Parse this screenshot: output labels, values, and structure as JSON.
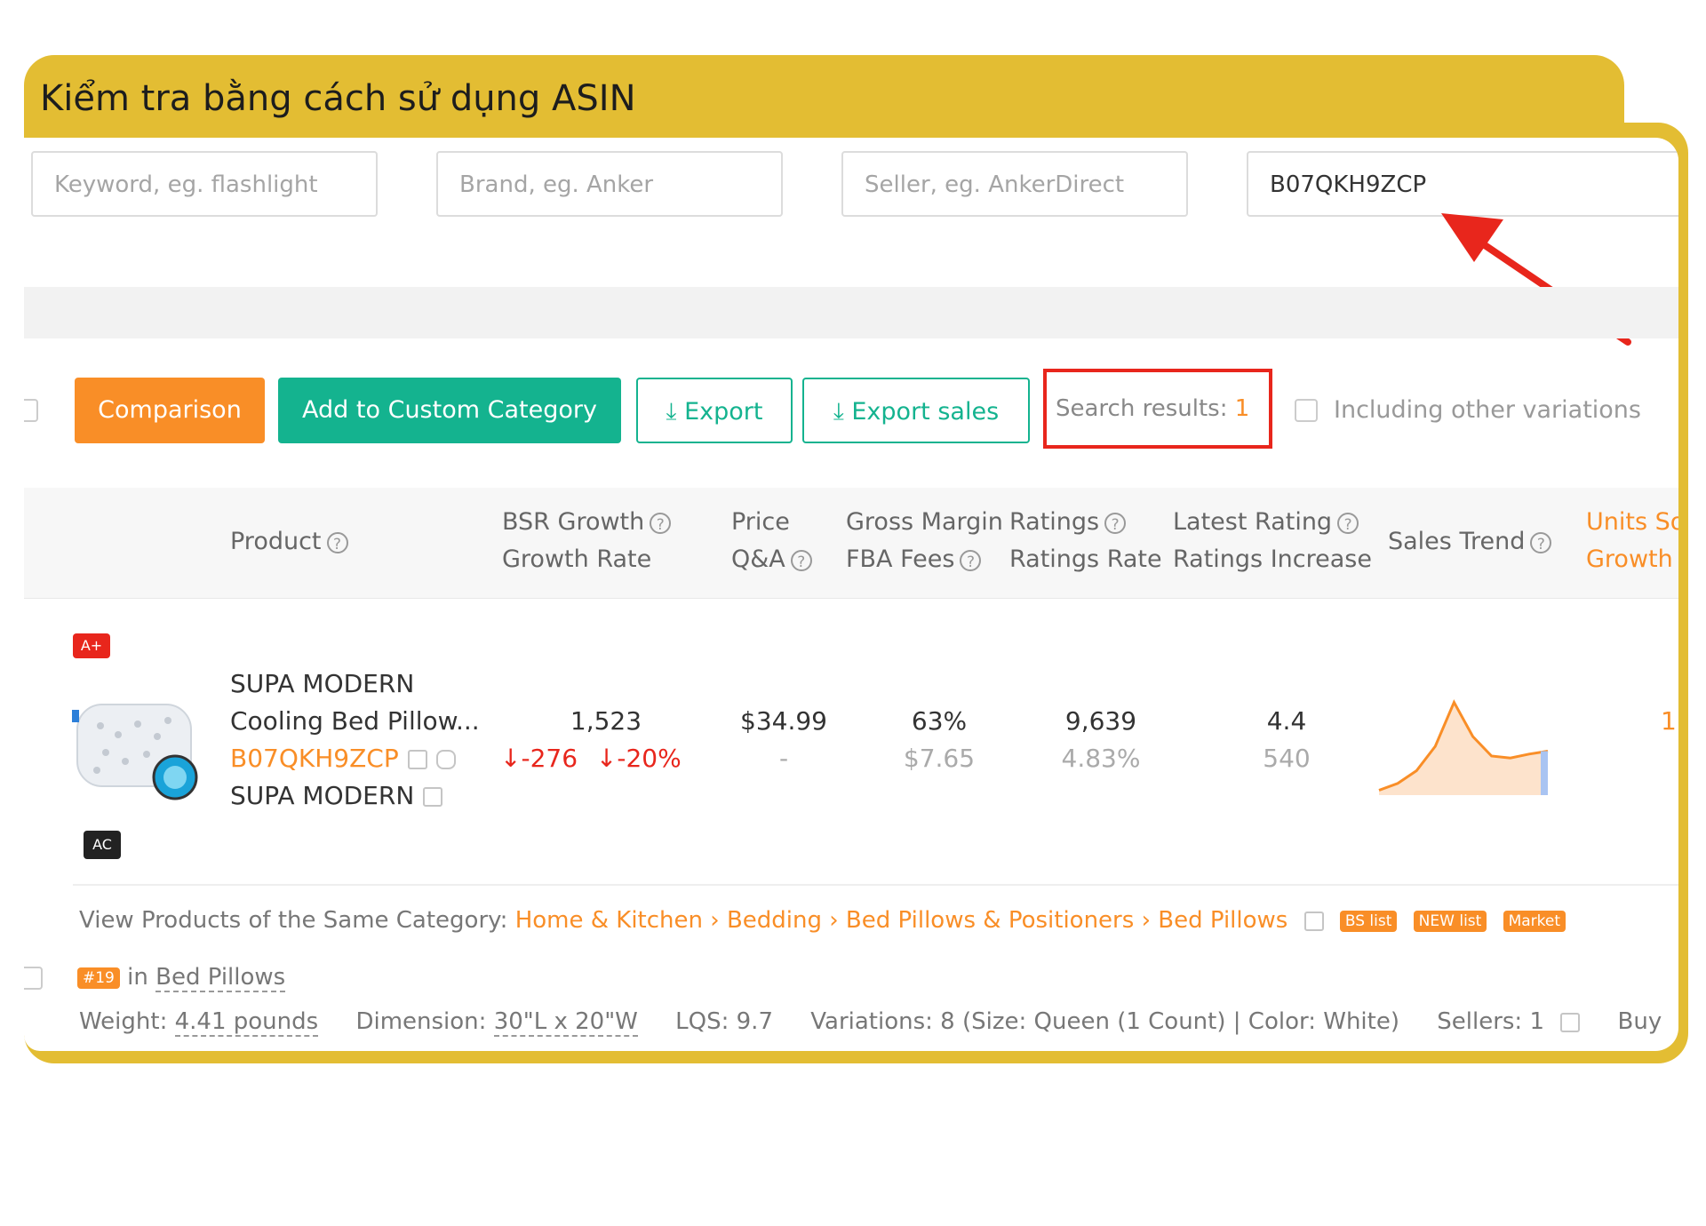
{
  "banner": {
    "title": "Kiểm tra bằng cách sử dụng ASIN"
  },
  "filters": {
    "keyword_placeholder": "Keyword, eg. flashlight",
    "brand_placeholder": "Brand, eg. Anker",
    "seller_placeholder": "Seller, eg. AnkerDirect",
    "asin_value": "B07QKH9ZCP"
  },
  "toolbar": {
    "comparison": "Comparison",
    "add_custom": "Add to Custom Category",
    "export": "Export",
    "export_sales": "Export sales",
    "search_results_label": "Search results: ",
    "search_results_count": "1",
    "including_variations": "Including other variations"
  },
  "columns": {
    "product": "Product",
    "bsr_growth": "BSR Growth",
    "growth_rate": "Growth Rate",
    "price": "Price",
    "qa": "Q&A",
    "gross_margin": "Gross Margin",
    "fba_fees": "FBA Fees",
    "ratings": "Ratings",
    "ratings_rate": "Ratings Rate",
    "latest_rating": "Latest Rating",
    "ratings_increase": "Ratings Increase",
    "sales_trend": "Sales Trend",
    "units_sold": "Units So",
    "growth": "Growth"
  },
  "product": {
    "badge_aplus": "A+",
    "badge_ac": "AC",
    "brand": "SUPA MODERN",
    "name": "Cooling Bed Pillow...",
    "asin": "B07QKH9ZCP",
    "seller": "SUPA MODERN",
    "bsr": "1,523",
    "bsr_growth": "-276",
    "growth_rate": "-20%",
    "price": "$34.99",
    "qa": "-",
    "gross_margin": "63%",
    "fba_fees": "$7.65",
    "ratings": "9,639",
    "ratings_rate": "4.83%",
    "latest_rating": "4.4",
    "ratings_increase": "540",
    "units_partial": "1"
  },
  "sales_trend": [
    0.05,
    0.12,
    0.25,
    0.5,
    0.95,
    0.6,
    0.4,
    0.38,
    0.42,
    0.45
  ],
  "category": {
    "label": "View Products of the Same Category:",
    "path_1": "Home & Kitchen",
    "path_2": "Bedding",
    "path_3": "Bed Pillows & Positioners",
    "path_4": "Bed Pillows",
    "tag_bs": "BS list",
    "tag_new": "NEW list",
    "tag_market": "Market"
  },
  "rank": {
    "badge": "#19",
    "in": "in",
    "category": "Bed Pillows"
  },
  "details": {
    "weight_label": "Weight:",
    "weight_value": "4.41 pounds",
    "dimension_label": "Dimension:",
    "dimension_value": "30\"L x 20\"W",
    "lqs": "LQS: 9.7",
    "variations": "Variations: 8 (Size: Queen (1 Count) | Color: White)",
    "sellers": "Sellers: 1",
    "buy": "Buy"
  },
  "colors": {
    "frame": "#E3BD33",
    "accent_orange": "#F98E27",
    "accent_green": "#14B38F",
    "alert_red": "#E8261C"
  }
}
